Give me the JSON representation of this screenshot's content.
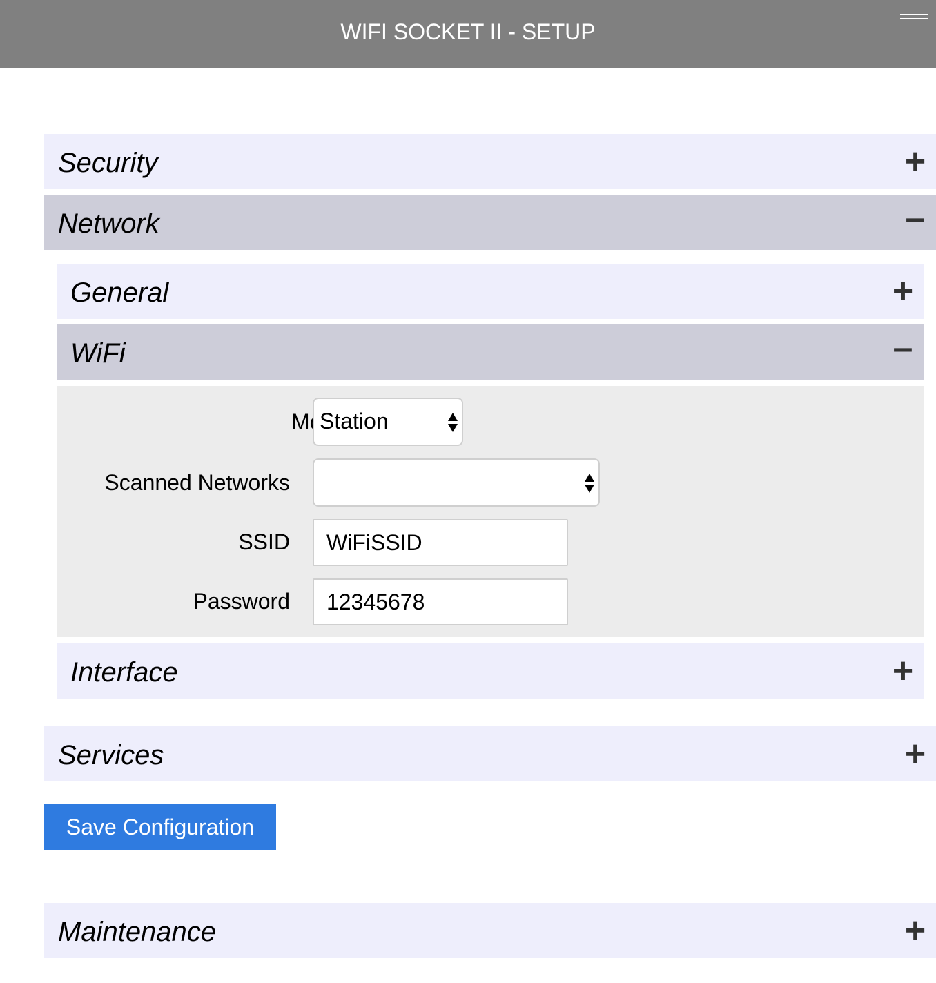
{
  "header": {
    "title": "WIFI SOCKET II - SETUP",
    "menu_icon": "hamburger-menu-icon",
    "background_color": "#808080"
  },
  "sections": {
    "security": {
      "label": "Security",
      "expanded": false,
      "sign": "+"
    },
    "network": {
      "label": "Network",
      "expanded": true,
      "sign": "–",
      "subsections": {
        "general": {
          "label": "General",
          "expanded": false,
          "sign": "+"
        },
        "wifi": {
          "label": "WiFi",
          "expanded": true,
          "sign": "–",
          "fields": {
            "mode": {
              "label": "Mode",
              "value": "Station"
            },
            "scanned_networks": {
              "label": "Scanned Networks",
              "value": ""
            },
            "ssid": {
              "label": "SSID",
              "value": "WiFiSSID"
            },
            "password": {
              "label": "Password",
              "value": "12345678"
            }
          }
        },
        "interface": {
          "label": "Interface",
          "expanded": false,
          "sign": "+"
        }
      }
    },
    "services": {
      "label": "Services",
      "expanded": false,
      "sign": "+"
    },
    "maintenance": {
      "label": "Maintenance",
      "expanded": false,
      "sign": "+"
    }
  },
  "actions": {
    "save_label": "Save Configuration",
    "save_color": "#2f7be0"
  },
  "colors": {
    "collapsed_header": "#eeeefc",
    "expanded_header": "#cdcdd9",
    "panel_background": "#ececec"
  }
}
